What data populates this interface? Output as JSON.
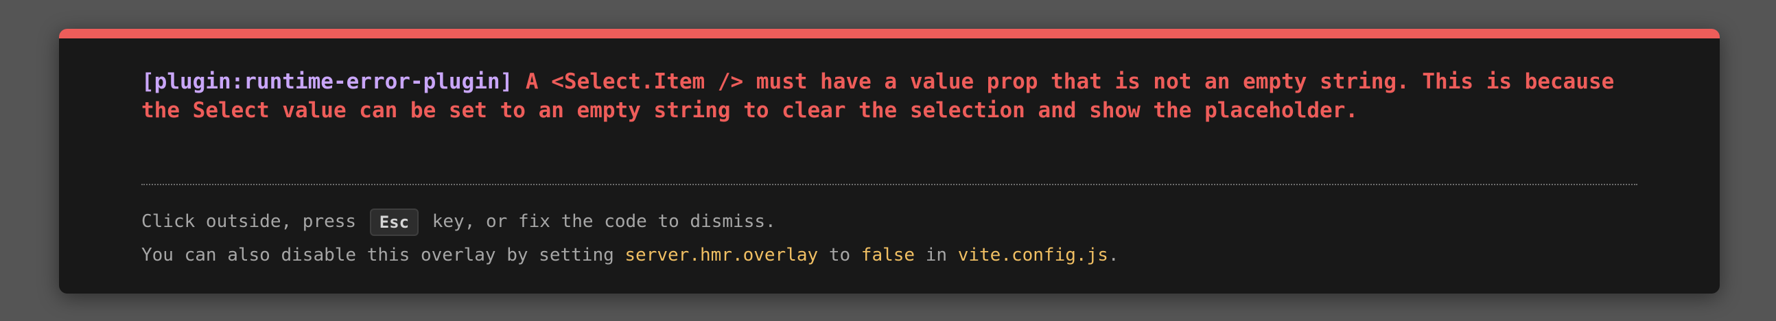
{
  "error": {
    "plugin": "[plugin:runtime-error-plugin]",
    "message": "A <Select.Item /> must have a value prop that is not an empty string. This is because the Select value can be set to an empty string to clear the selection and show the placeholder."
  },
  "tip": {
    "line1_before": "Click outside, press",
    "key": "Esc",
    "line1_after": "key, or fix the code to dismiss.",
    "line2_before": "You can also disable this overlay by setting",
    "setting": "server.hmr.overlay",
    "to": "to",
    "value": "false",
    "in": "in",
    "file": "vite.config.js",
    "period": "."
  },
  "colors": {
    "accent": "#ee5d5a",
    "plugin": "#c9a6f8",
    "code": "#f0bf63",
    "background": "#181818",
    "backdrop": "#555555"
  }
}
